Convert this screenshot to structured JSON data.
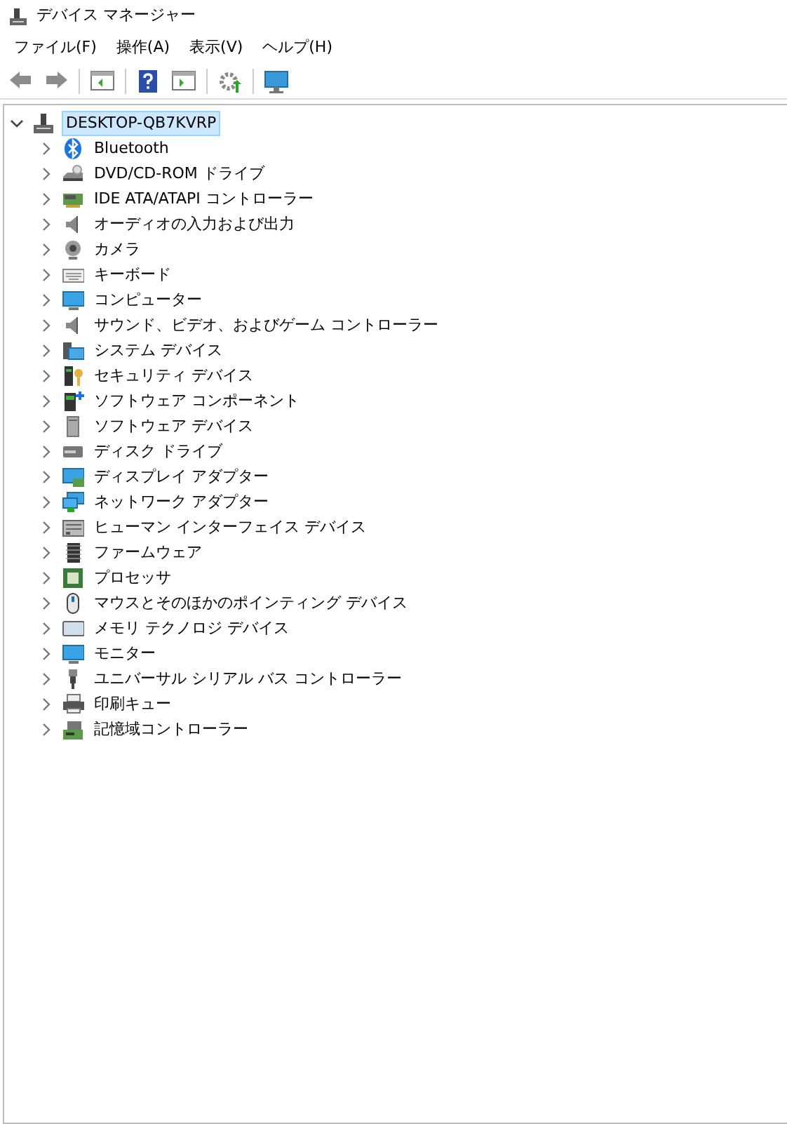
{
  "window": {
    "title": "デバイス マネージャー"
  },
  "menu": [
    "ファイル(F)",
    "操作(A)",
    "表示(V)",
    "ヘルプ(H)"
  ],
  "tree": {
    "label": "DESKTOP-QB7KVRP",
    "expanded": true,
    "selected": true,
    "children": [
      {
        "label": "Bluetooth",
        "expanded": false
      },
      {
        "label": "DVD/CD-ROM ドライブ",
        "expanded": false
      },
      {
        "label": "IDE ATA/ATAPI コントローラー",
        "expanded": false
      },
      {
        "label": "オーディオの入力および出力",
        "expanded": false
      },
      {
        "label": "カメラ",
        "expanded": false
      },
      {
        "label": "キーボード",
        "expanded": false
      },
      {
        "label": "コンピューター",
        "expanded": false
      },
      {
        "label": "サウンド、ビデオ、およびゲーム コントローラー",
        "expanded": false
      },
      {
        "label": "システム デバイス",
        "expanded": false
      },
      {
        "label": "セキュリティ デバイス",
        "expanded": false
      },
      {
        "label": "ソフトウェア コンポーネント",
        "expanded": false
      },
      {
        "label": "ソフトウェア デバイス",
        "expanded": false
      },
      {
        "label": "ディスク ドライブ",
        "expanded": false
      },
      {
        "label": "ディスプレイ アダプター",
        "expanded": false
      },
      {
        "label": "ネットワーク アダプター",
        "expanded": false
      },
      {
        "label": "ヒューマン インターフェイス デバイス",
        "expanded": false
      },
      {
        "label": "ファームウェア",
        "expanded": false
      },
      {
        "label": "プロセッサ",
        "expanded": false
      },
      {
        "label": "マウスとそのほかのポインティング デバイス",
        "expanded": false
      },
      {
        "label": "メモリ テクノロジ デバイス",
        "expanded": false
      },
      {
        "label": "モニター",
        "expanded": false
      },
      {
        "label": "ユニバーサル シリアル バス コントローラー",
        "expanded": false
      },
      {
        "label": "印刷キュー",
        "expanded": false
      },
      {
        "label": "記憶域コントローラー",
        "expanded": false
      }
    ]
  }
}
